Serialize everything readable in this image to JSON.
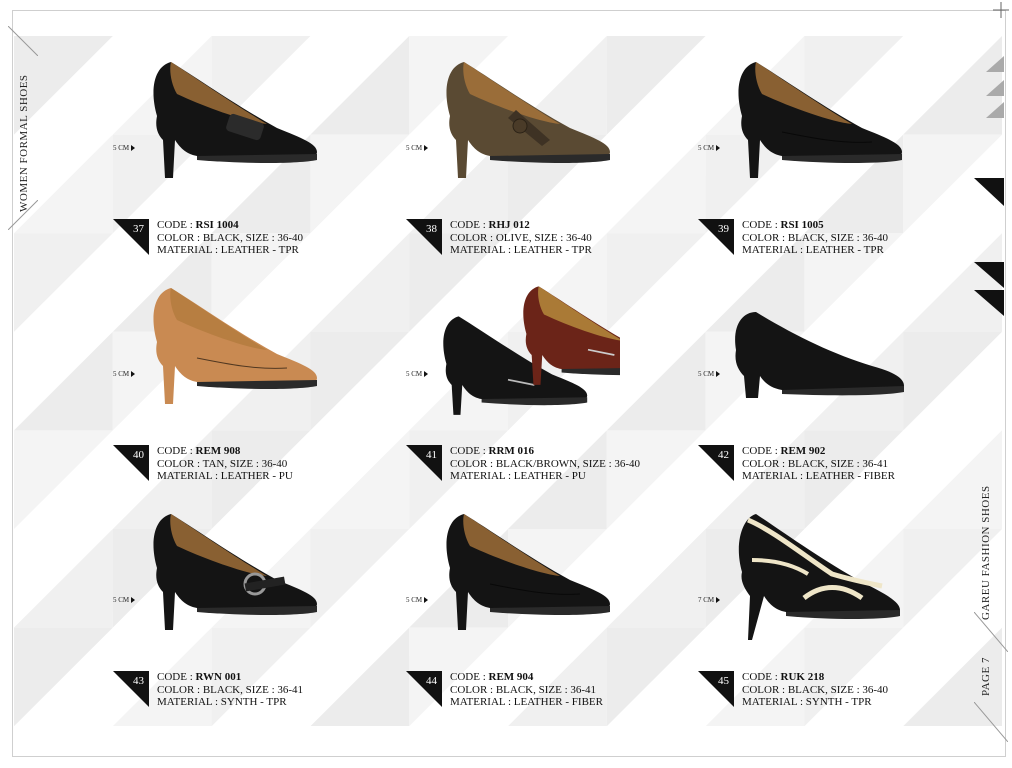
{
  "side_left_title": "WOMEN  FORMAL SHOES",
  "side_right_title": "GAREU FASHION SHOES",
  "page_label": "PAGE 7",
  "code_prefix": "CODE : ",
  "items": [
    {
      "number": "37",
      "code": "RSI 1004",
      "color_line": "COLOR : BLACK, SIZE : 36-40",
      "material_line": "MATERIAL : LEATHER - TPR",
      "heel": "5 CM",
      "shoe_color": "#141414",
      "style": "loafer-pump",
      "second_color": null
    },
    {
      "number": "38",
      "code": "RHJ 012",
      "color_line": "COLOR : OLIVE, SIZE : 36-40",
      "material_line": "MATERIAL : LEATHER - TPR",
      "heel": "5 CM",
      "shoe_color": "#5a4a33",
      "style": "strap-pump",
      "second_color": null
    },
    {
      "number": "39",
      "code": "RSI 1005",
      "color_line": "COLOR : BLACK, SIZE : 36-40",
      "material_line": "MATERIAL : LEATHER - TPR",
      "heel": "5 CM",
      "shoe_color": "#141414",
      "style": "pump",
      "second_color": null
    },
    {
      "number": "40",
      "code": "REM 908",
      "color_line": "COLOR : TAN, SIZE : 36-40",
      "material_line": "MATERIAL : LEATHER - PU",
      "heel": "5 CM",
      "shoe_color": "#c98a52",
      "style": "pump",
      "second_color": null
    },
    {
      "number": "41",
      "code": "RRM 016",
      "color_line": "COLOR : BLACK/BROWN, SIZE : 36-40",
      "material_line": "MATERIAL : LEATHER - PU",
      "heel": "5 CM",
      "shoe_color": "#141414",
      "style": "pair",
      "second_color": "#6b2418"
    },
    {
      "number": "42",
      "code": "REM 902",
      "color_line": "COLOR : BLACK, SIZE : 36-41",
      "material_line": "MATERIAL : LEATHER - FIBER",
      "heel": "5 CM",
      "shoe_color": "#141414",
      "style": "low-pump",
      "second_color": null
    },
    {
      "number": "43",
      "code": "RWN 001",
      "color_line": "COLOR : BLACK, SIZE : 36-41",
      "material_line": "MATERIAL : SYNTH - TPR",
      "heel": "5 CM",
      "shoe_color": "#141414",
      "style": "buckle-pump",
      "second_color": null
    },
    {
      "number": "44",
      "code": "REM 904",
      "color_line": "COLOR : BLACK, SIZE : 36-41",
      "material_line": "MATERIAL : LEATHER - FIBER",
      "heel": "5 CM",
      "shoe_color": "#141414",
      "style": "pump",
      "second_color": null
    },
    {
      "number": "45",
      "code": "RUK 218",
      "color_line": "COLOR : BLACK, SIZE : 36-40",
      "material_line": "MATERIAL : SYNTH - TPR",
      "heel": "7 CM",
      "shoe_color": "#141414",
      "style": "stiletto-cream",
      "second_color": "#efe6c8"
    }
  ]
}
